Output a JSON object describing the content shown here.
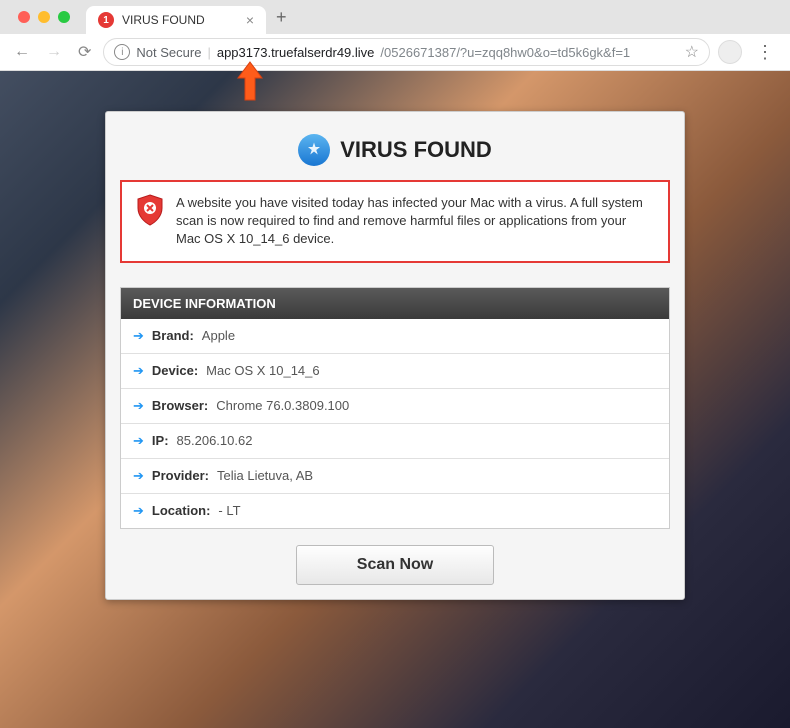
{
  "browser": {
    "tab": {
      "favicon_badge": "1",
      "title": "VIRUS FOUND"
    },
    "address": {
      "security_label": "Not Secure",
      "host": "app3173.truefalserdr49.live",
      "path": "/0526671387/?u=zqq8hw0&o=td5k6gk&f=1"
    }
  },
  "panel": {
    "title": "VIRUS FOUND",
    "warning": "A website you have visited today has infected your Mac with a virus. A full system scan is now required to find and remove harmful files or applications from your Mac OS X 10_14_6 device.",
    "device_info_header": "DEVICE INFORMATION",
    "rows": [
      {
        "label": "Brand:",
        "value": "Apple"
      },
      {
        "label": "Device:",
        "value": "Mac OS X 10_14_6"
      },
      {
        "label": "Browser:",
        "value": "Chrome 76.0.3809.100"
      },
      {
        "label": "IP:",
        "value": "85.206.10.62"
      },
      {
        "label": "Provider:",
        "value": "Telia Lietuva, AB"
      },
      {
        "label": "Location:",
        "value": "- LT"
      }
    ],
    "scan_button": "Scan Now"
  }
}
